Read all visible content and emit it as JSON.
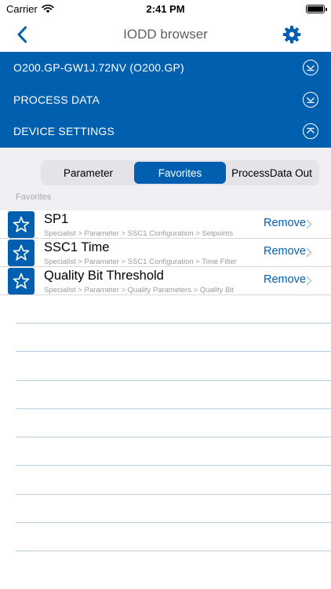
{
  "status_bar": {
    "carrier": "Carrier",
    "time": "2:41 PM"
  },
  "nav": {
    "title": "IODD browser",
    "back_icon": "chevron-left-icon",
    "settings_icon": "gear-icon"
  },
  "device_panel": {
    "rows": [
      {
        "label": "O200.GP-GW1J.72NV (O200.GP)",
        "icon": "expand-icon"
      },
      {
        "label": "PROCESS DATA",
        "icon": "expand-icon"
      },
      {
        "label": "DEVICE SETTINGS",
        "icon": "collapse-icon"
      }
    ]
  },
  "tabs": {
    "items": [
      "Parameter",
      "Favorites",
      "ProcessData Out"
    ],
    "active": "Favorites"
  },
  "section_header": "Favorites",
  "favorites": [
    {
      "title": "SP1",
      "path": "Specialist > Parameter > SSC1 Configuration > Setpoints",
      "remove_label": "Remove"
    },
    {
      "title": "SSC1 Time",
      "path": "Specialist > Parameter > SSC1 Configuration > Time Filter",
      "remove_label": "Remove"
    },
    {
      "title": "Quality Bit Threshold",
      "path": "Specialist > Parameter > Quality Parameters > Quality Bit",
      "remove_label": "Remove"
    }
  ],
  "colors": {
    "brand_blue": "#0060af",
    "grey_background": "#efeff4",
    "empty_line": "#b7cde0"
  }
}
